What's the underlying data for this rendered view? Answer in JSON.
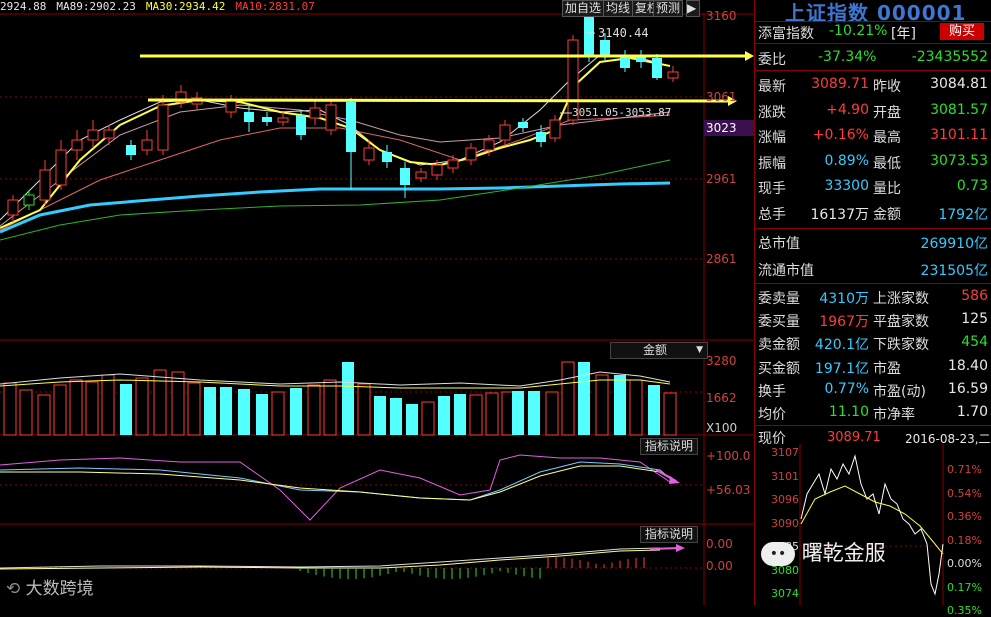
{
  "legend": {
    "ma5": "2924.88",
    "ma89_label": "MA89:",
    "ma89": "2902.23",
    "ma30_label": "MA30:",
    "ma30": "2934.42",
    "ma10_label": "MA10:",
    "ma10": "2831.07"
  },
  "toolbar": {
    "add": "加自选",
    "avg": "均线",
    "rights": "复权",
    "predict": "预测"
  },
  "price_axis": [
    "3160",
    "3061",
    "3023",
    "2961",
    "2861"
  ],
  "annotations": {
    "high": "3140.44",
    "range": "3051.05-3053.87"
  },
  "volume": {
    "selector": "金额",
    "axis": [
      "3280",
      "1662",
      "X100"
    ]
  },
  "indicator1": {
    "button": "指标说明",
    "axis": [
      "+100.0",
      "+56.03"
    ]
  },
  "indicator2": {
    "button": "指标说明",
    "axis": [
      "0.00",
      "0.00"
    ]
  },
  "panel": {
    "title": "上证指数 000001",
    "sub_label": "添富指数",
    "sub_value": "-10.21%",
    "sub_unit": "[年]",
    "buy": "购买",
    "ratio_label": "委比",
    "ratio_value": "-37.34%",
    "ratio_diff": "-23435552",
    "quotes": [
      {
        "l1": "最新",
        "v1": "3089.71",
        "c1": "red",
        "l2": "昨收",
        "v2": "3084.81",
        "c2": "white"
      },
      {
        "l1": "涨跌",
        "v1": "+4.90",
        "c1": "red",
        "l2": "开盘",
        "v2": "3081.57",
        "c2": "green"
      },
      {
        "l1": "涨幅",
        "v1": "+0.16%",
        "c1": "red",
        "l2": "最高",
        "v2": "3101.11",
        "c2": "red"
      },
      {
        "l1": "振幅",
        "v1": "0.89%",
        "c1": "cyan",
        "l2": "最低",
        "v2": "3073.53",
        "c2": "green"
      },
      {
        "l1": "现手",
        "v1": "33300",
        "c1": "cyan",
        "l2": "量比",
        "v2": "0.73",
        "c2": "green"
      },
      {
        "l1": "总手",
        "v1": "16137万",
        "c1": "white",
        "l2": "金额",
        "v2": "1792亿",
        "c2": "cyan"
      }
    ],
    "market_cap_label": "总市值",
    "market_cap": "269910亿",
    "float_cap_label": "流通市值",
    "float_cap": "231505亿",
    "stats": [
      {
        "l1": "委卖量",
        "v1": "4310万",
        "c1": "cyan",
        "l2": "上涨家数",
        "v2": "586",
        "c2": "red"
      },
      {
        "l1": "委买量",
        "v1": "1967万",
        "c1": "red",
        "l2": "平盘家数",
        "v2": "125",
        "c2": "white"
      },
      {
        "l1": "卖金额",
        "v1": "420.1亿",
        "c1": "cyan",
        "l2": "下跌家数",
        "v2": "454",
        "c2": "green"
      },
      {
        "l1": "买金额",
        "v1": "197.1亿",
        "c1": "cyan",
        "l2": "市盈",
        "v2": "18.40",
        "c2": "white"
      },
      {
        "l1": "换手",
        "v1": "0.77%",
        "c1": "cyan",
        "l2": "市盈(动)",
        "v2": "16.59",
        "c2": "white"
      },
      {
        "l1": "均价",
        "v1": "11.10",
        "c1": "green",
        "l2": "市净率",
        "v2": "1.70",
        "c2": "white"
      }
    ],
    "intraday_label": "现价",
    "intraday_price": "3089.71",
    "intraday_date": "2016-08-23,二",
    "intraday_left": [
      "3107",
      "3101",
      "3096",
      "3090",
      "3085",
      "3080",
      "3074"
    ],
    "intraday_right": [
      "0.71%",
      "0.54%",
      "0.36%",
      "0.18%",
      "0.00%",
      "0.17%",
      "0.35%"
    ]
  },
  "watermark": {
    "left": "大数跨境",
    "right": "曙乾金服"
  }
}
